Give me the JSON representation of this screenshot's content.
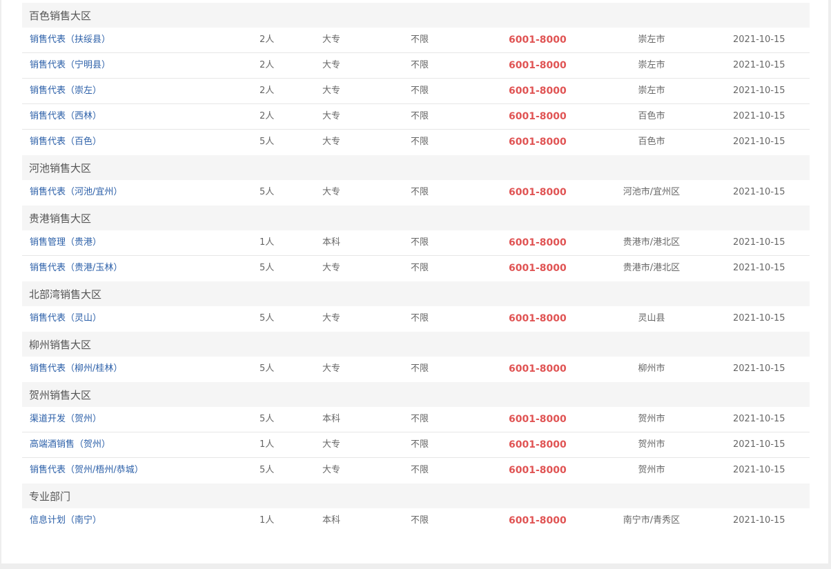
{
  "colors": {
    "title_link": "#2b5fa8",
    "salary": "#e05454",
    "group_header_bg": "#f5f5f5",
    "page_bg": "#eeeeee"
  },
  "groups": [
    {
      "name": "百色销售大区",
      "jobs": [
        {
          "title": "销售代表（扶绥县）",
          "count": "2人",
          "education": "大专",
          "experience": "不限",
          "salary": "6001-8000",
          "location": "崇左市",
          "date": "2021-10-15"
        },
        {
          "title": "销售代表（宁明县）",
          "count": "2人",
          "education": "大专",
          "experience": "不限",
          "salary": "6001-8000",
          "location": "崇左市",
          "date": "2021-10-15"
        },
        {
          "title": "销售代表（崇左）",
          "count": "2人",
          "education": "大专",
          "experience": "不限",
          "salary": "6001-8000",
          "location": "崇左市",
          "date": "2021-10-15"
        },
        {
          "title": "销售代表（西林）",
          "count": "2人",
          "education": "大专",
          "experience": "不限",
          "salary": "6001-8000",
          "location": "百色市",
          "date": "2021-10-15"
        },
        {
          "title": "销售代表（百色）",
          "count": "5人",
          "education": "大专",
          "experience": "不限",
          "salary": "6001-8000",
          "location": "百色市",
          "date": "2021-10-15"
        }
      ]
    },
    {
      "name": "河池销售大区",
      "jobs": [
        {
          "title": "销售代表（河池/宜州）",
          "count": "5人",
          "education": "大专",
          "experience": "不限",
          "salary": "6001-8000",
          "location": "河池市/宜州区",
          "date": "2021-10-15"
        }
      ]
    },
    {
      "name": "贵港销售大区",
      "jobs": [
        {
          "title": "销售管理（贵港）",
          "count": "1人",
          "education": "本科",
          "experience": "不限",
          "salary": "6001-8000",
          "location": "贵港市/港北区",
          "date": "2021-10-15"
        },
        {
          "title": "销售代表（贵港/玉林）",
          "count": "5人",
          "education": "大专",
          "experience": "不限",
          "salary": "6001-8000",
          "location": "贵港市/港北区",
          "date": "2021-10-15"
        }
      ]
    },
    {
      "name": "北部湾销售大区",
      "jobs": [
        {
          "title": "销售代表（灵山）",
          "count": "5人",
          "education": "大专",
          "experience": "不限",
          "salary": "6001-8000",
          "location": "灵山县",
          "date": "2021-10-15"
        }
      ]
    },
    {
      "name": "柳州销售大区",
      "jobs": [
        {
          "title": "销售代表（柳州/桂林）",
          "count": "5人",
          "education": "大专",
          "experience": "不限",
          "salary": "6001-8000",
          "location": "柳州市",
          "date": "2021-10-15"
        }
      ]
    },
    {
      "name": "贺州销售大区",
      "jobs": [
        {
          "title": "渠道开发（贺州）",
          "count": "5人",
          "education": "本科",
          "experience": "不限",
          "salary": "6001-8000",
          "location": "贺州市",
          "date": "2021-10-15"
        },
        {
          "title": "高端酒销售（贺州）",
          "count": "1人",
          "education": "大专",
          "experience": "不限",
          "salary": "6001-8000",
          "location": "贺州市",
          "date": "2021-10-15"
        },
        {
          "title": "销售代表（贺州/梧州/恭城）",
          "count": "5人",
          "education": "大专",
          "experience": "不限",
          "salary": "6001-8000",
          "location": "贺州市",
          "date": "2021-10-15"
        }
      ]
    },
    {
      "name": "专业部门",
      "jobs": [
        {
          "title": "信息计划（南宁）",
          "count": "1人",
          "education": "本科",
          "experience": "不限",
          "salary": "6001-8000",
          "location": "南宁市/青秀区",
          "date": "2021-10-15"
        }
      ]
    }
  ]
}
